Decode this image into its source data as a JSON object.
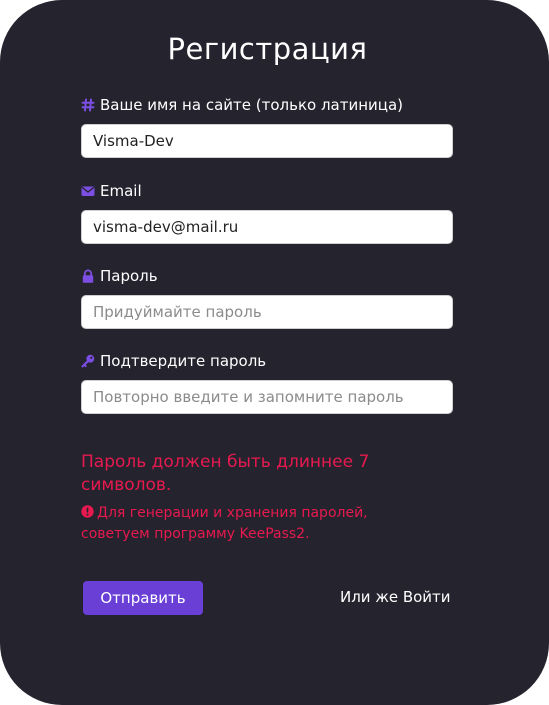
{
  "form": {
    "title": "Регистрация",
    "fields": [
      {
        "label": "Ваше имя на сайте (только латиница)",
        "icon": "hash-icon",
        "value": "Visma-Dev",
        "placeholder": ""
      },
      {
        "label": "Email",
        "icon": "envelope-icon",
        "value": "visma-dev@mail.ru",
        "placeholder": ""
      },
      {
        "label": "Пароль",
        "icon": "lock-icon",
        "value": "",
        "placeholder": "Придуймайте пароль"
      },
      {
        "label": "Подтвердите пароль",
        "icon": "key-icon",
        "value": "",
        "placeholder": "Повторно введите и запомните пароль"
      }
    ],
    "error_message": "Пароль должен быть длиннее 7 символов.",
    "hint_message": "Для генерации и хранения паролей, советуем программу KeePass2.",
    "submit_label": "Отправить",
    "login_link": "Или же Войти"
  },
  "colors": {
    "card_background": "#25232e",
    "accent": "#6a3fd6",
    "icon": "#7c4ee4",
    "error": "#e8194f"
  }
}
